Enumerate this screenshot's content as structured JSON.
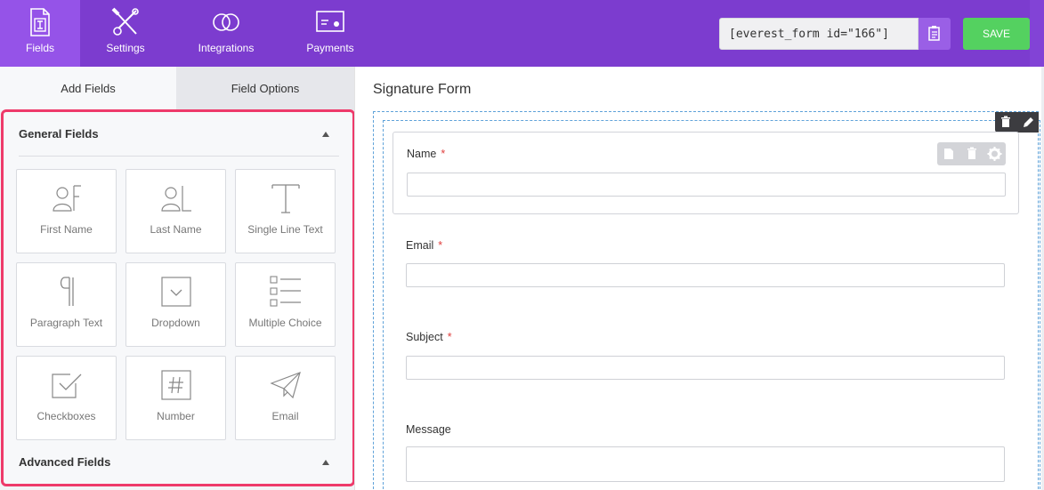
{
  "topbar": {
    "nav": [
      {
        "label": "Fields",
        "icon": "fields-icon",
        "active": true
      },
      {
        "label": "Settings",
        "icon": "settings-icon",
        "active": false
      },
      {
        "label": "Integrations",
        "icon": "integrations-icon",
        "active": false
      },
      {
        "label": "Payments",
        "icon": "payments-icon",
        "active": false
      }
    ],
    "shortcode_value": "[everest_form id=\"166\"]",
    "copy_icon": "clipboard-icon",
    "save_label": "SAVE",
    "colors": {
      "bar": "#7c3ccf",
      "active_tab": "#9553e8",
      "save": "#54d160"
    }
  },
  "sidebar": {
    "tabs": [
      {
        "label": "Add Fields"
      },
      {
        "label": "Field Options"
      }
    ],
    "general_title": "General Fields",
    "advanced_title": "Advanced Fields",
    "fields": [
      {
        "label": "First Name",
        "icon": "first-name-icon"
      },
      {
        "label": "Last Name",
        "icon": "last-name-icon"
      },
      {
        "label": "Single Line Text",
        "icon": "single-line-text-icon"
      },
      {
        "label": "Paragraph Text",
        "icon": "paragraph-icon"
      },
      {
        "label": "Dropdown",
        "icon": "dropdown-icon"
      },
      {
        "label": "Multiple Choice",
        "icon": "multiple-choice-icon"
      },
      {
        "label": "Checkboxes",
        "icon": "checkbox-icon"
      },
      {
        "label": "Number",
        "icon": "number-icon"
      },
      {
        "label": "Email",
        "icon": "email-icon"
      }
    ],
    "highlight_color": "#ee3a6a"
  },
  "form": {
    "title": "Signature Form",
    "fields": [
      {
        "label": "Name",
        "required": "*"
      },
      {
        "label": "Email",
        "required": "*"
      },
      {
        "label": "Subject",
        "required": "*"
      },
      {
        "label": "Message",
        "required": ""
      }
    ]
  }
}
